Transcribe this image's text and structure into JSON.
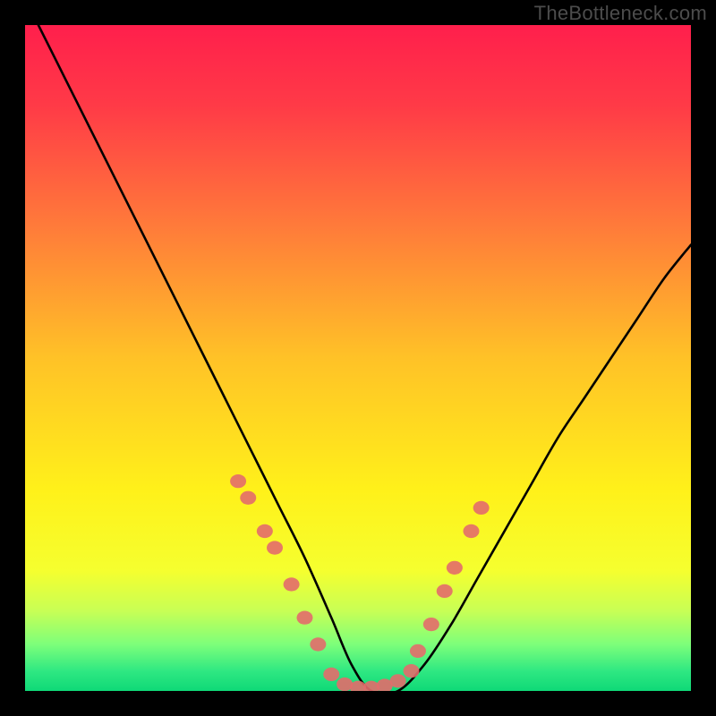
{
  "watermark": "TheBottleneck.com",
  "chart_data": {
    "type": "line",
    "title": "",
    "xlabel": "",
    "ylabel": "",
    "xlim": [
      0,
      100
    ],
    "ylim": [
      0,
      100
    ],
    "background_gradient_stops": [
      {
        "offset": 0.0,
        "color": "#ff1f4c"
      },
      {
        "offset": 0.12,
        "color": "#ff3a47"
      },
      {
        "offset": 0.3,
        "color": "#ff7a3a"
      },
      {
        "offset": 0.5,
        "color": "#ffc227"
      },
      {
        "offset": 0.7,
        "color": "#fff11a"
      },
      {
        "offset": 0.82,
        "color": "#f5ff2f"
      },
      {
        "offset": 0.88,
        "color": "#c8ff55"
      },
      {
        "offset": 0.93,
        "color": "#7dff7a"
      },
      {
        "offset": 0.97,
        "color": "#2fe882"
      },
      {
        "offset": 1.0,
        "color": "#0fd977"
      }
    ],
    "series": [
      {
        "name": "bottleneck-curve",
        "type": "line",
        "color": "#000000",
        "x": [
          2,
          6,
          10,
          14,
          18,
          22,
          26,
          30,
          34,
          38,
          42,
          46,
          49,
          52,
          56,
          60,
          64,
          68,
          72,
          76,
          80,
          84,
          88,
          92,
          96,
          100
        ],
        "y": [
          100,
          92,
          84,
          76,
          68,
          60,
          52,
          44,
          36,
          28,
          20,
          11,
          4,
          0,
          0,
          4,
          10,
          17,
          24,
          31,
          38,
          44,
          50,
          56,
          62,
          67
        ]
      },
      {
        "name": "highlight-dots-left",
        "type": "scatter",
        "color": "#e36b6b",
        "x": [
          32,
          33.5,
          36,
          37.5,
          40,
          42,
          44
        ],
        "y": [
          31.5,
          29,
          24,
          21.5,
          16,
          11,
          7
        ]
      },
      {
        "name": "highlight-cluster-bottom",
        "type": "scatter",
        "color": "#e36b6b",
        "x": [
          46,
          48,
          50,
          52,
          54,
          56,
          58
        ],
        "y": [
          2.5,
          1,
          0.5,
          0.5,
          0.8,
          1.5,
          3
        ]
      },
      {
        "name": "highlight-dots-right",
        "type": "scatter",
        "color": "#e36b6b",
        "x": [
          59,
          61,
          63,
          64.5,
          67,
          68.5
        ],
        "y": [
          6,
          10,
          15,
          18.5,
          24,
          27.5
        ]
      }
    ]
  }
}
